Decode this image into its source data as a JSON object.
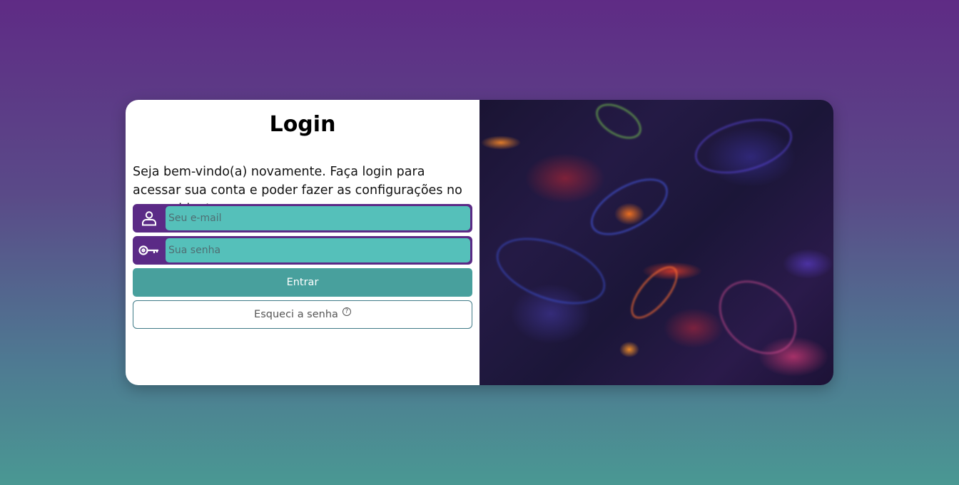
{
  "login": {
    "title": "Login",
    "welcome": "Seja bem-vindo(a) novamente. Faça login para acessar sua conta e poder fazer as configurações no seu ambiente.",
    "email": {
      "placeholder": "Seu e-mail",
      "value": "",
      "icon": "user-icon"
    },
    "password": {
      "placeholder": "Sua senha",
      "value": "",
      "icon": "key-icon"
    },
    "submit_label": "Entrar",
    "forgot_label": "Esqueci a senha",
    "forgot_icon": "question-circle-icon",
    "help_glyph": "?"
  },
  "colors": {
    "primary_purple": "#5b2a86",
    "input_teal": "#55c0ba",
    "button_teal": "#48a09d"
  }
}
